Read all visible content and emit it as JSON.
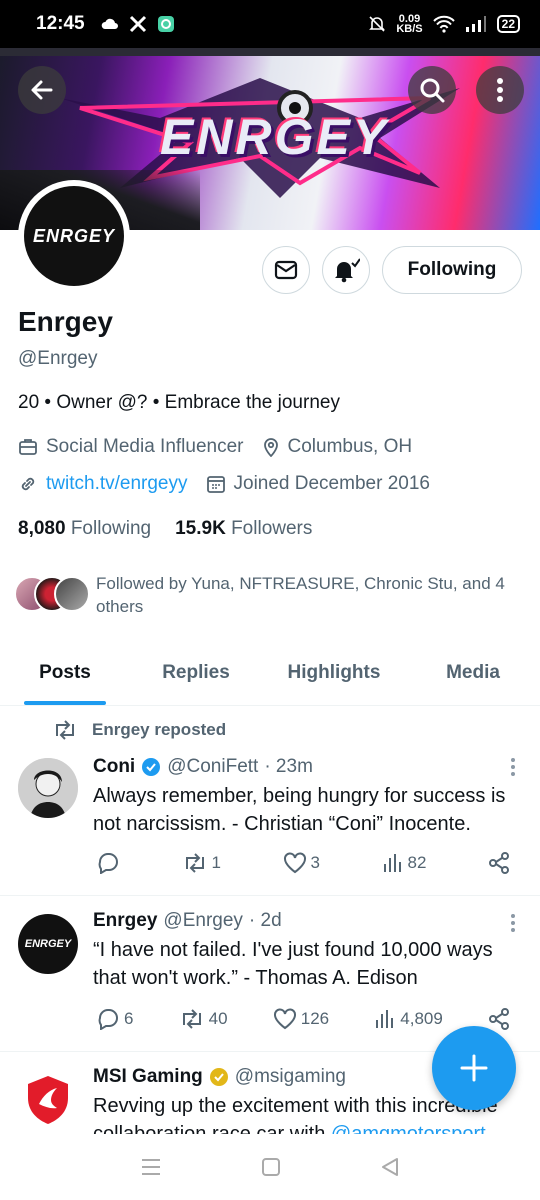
{
  "status_bar": {
    "time": "12:45",
    "net_speed": "0.09",
    "net_unit": "KB/S",
    "battery": "22"
  },
  "profile": {
    "banner_text": "ENRGEY",
    "avatar_text": "ENRGEY",
    "name": "Enrgey",
    "handle": "@Enrgey",
    "bio": "20 • Owner @? • Embrace the journey",
    "category": "Social Media Influencer",
    "location": "Columbus, OH",
    "link": "twitch.tv/enrgeyy",
    "joined": "Joined December 2016",
    "following_count": "8,080",
    "following_label": "Following",
    "followers_count": "15.9K",
    "followers_label": "Followers",
    "followed_by": "Followed by Yuna, NFTREASURE, Chronic Stu, and 4 others",
    "follow_button": "Following"
  },
  "tabs": [
    {
      "label": "Posts",
      "active": true
    },
    {
      "label": "Replies",
      "active": false
    },
    {
      "label": "Highlights",
      "active": false
    },
    {
      "label": "Media",
      "active": false
    }
  ],
  "posts": [
    {
      "reposted_by": "Enrgey reposted",
      "name": "Coni",
      "handle": "@ConiFett",
      "time": "· 23m",
      "text": "Always remember, being hungry for success is not narcissism. - Christian “Coni” Inocente.",
      "replies": "",
      "reposts": "1",
      "likes": "3",
      "views": "82"
    },
    {
      "name": "Enrgey",
      "handle": "@Enrgey",
      "time": "· 2d",
      "text": "“I have not failed. I've just found 10,000 ways that won't work.” - Thomas A. Edison",
      "replies": "6",
      "reposts": "40",
      "likes": "126",
      "views": "4,809"
    },
    {
      "name": "MSI Gaming",
      "handle": "@msigaming",
      "text_start": "Revving up the excitement with this incredible collaboration race car with ",
      "mention": "@amgmotorsport"
    }
  ],
  "colors": {
    "accent": "#1d9bf0",
    "muted": "#536471",
    "gold_badge": "#e2b719"
  }
}
